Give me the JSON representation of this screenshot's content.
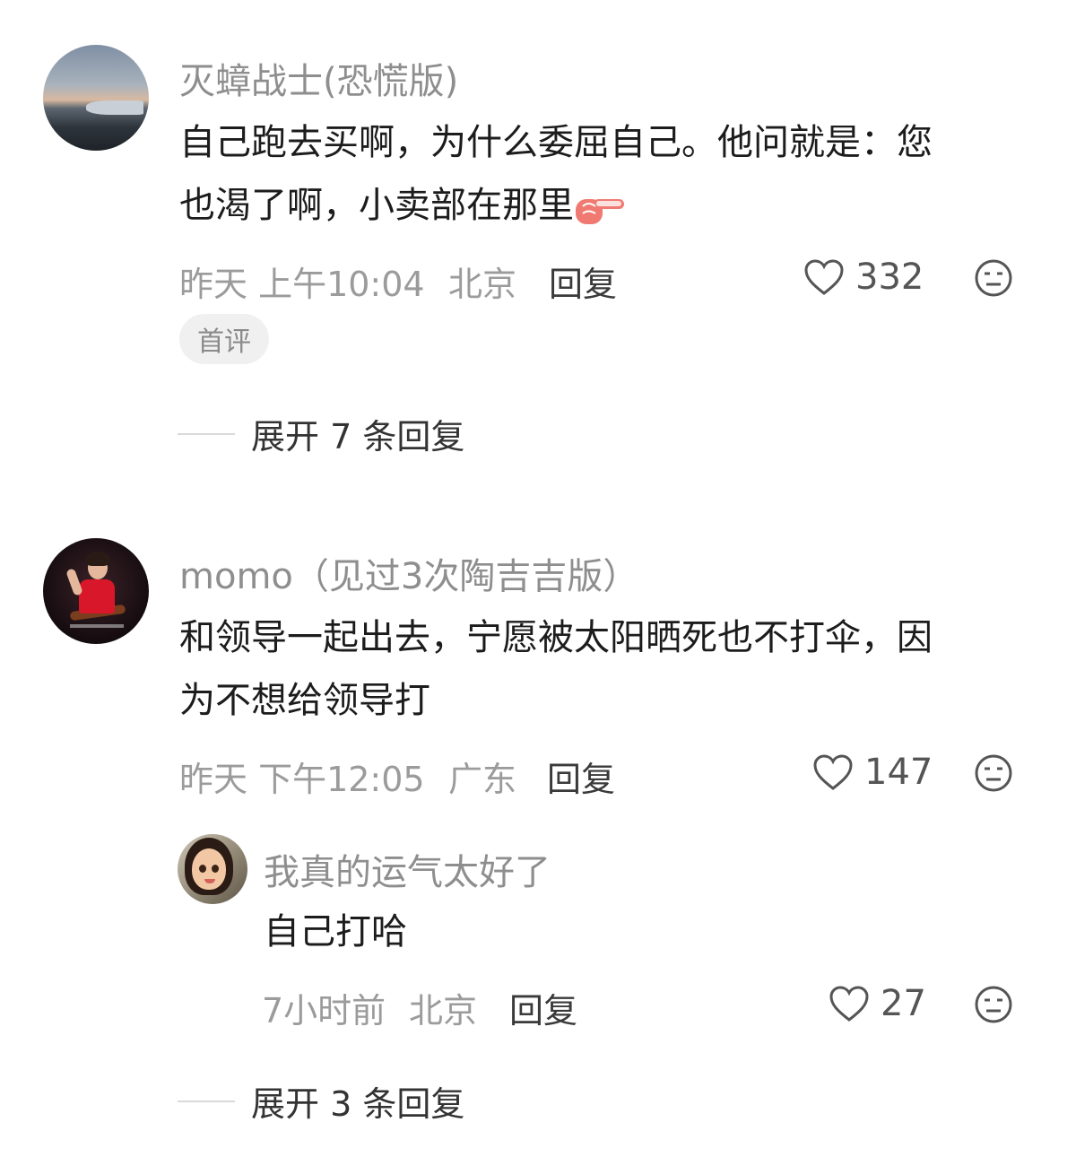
{
  "comments": [
    {
      "username": "灭蟑战士(恐慌版)",
      "text_line1": "自己跑去买啊，为什么委屈自己。他问就是：您",
      "text_line2": "也渴了啊，小卖部在那里",
      "emoji": "backhand-index-pointing-right-icon",
      "time": "昨天 上午10:04",
      "location": "北京",
      "reply_label": "回复",
      "likes": "332",
      "badge": "首评",
      "expand_label": "展开 7 条回复"
    },
    {
      "username": "momo（见过3次陶吉吉版）",
      "text_line1": "和领导一起出去，宁愿被太阳晒死也不打伞，因",
      "text_line2": "为不想给领导打",
      "time": "昨天 下午12:05",
      "location": "广东",
      "reply_label": "回复",
      "likes": "147",
      "sub_reply": {
        "username": "我真的运气太好了",
        "text": "自己打哈",
        "time": "7小时前",
        "location": "北京",
        "reply_label": "回复",
        "likes": "27"
      },
      "expand_label": "展开 3 条回复"
    }
  ],
  "colors": {
    "username": "#8e8e8e",
    "meta": "#9b9b9b",
    "text": "#1c1c1c",
    "emoji": "#f07a72"
  }
}
